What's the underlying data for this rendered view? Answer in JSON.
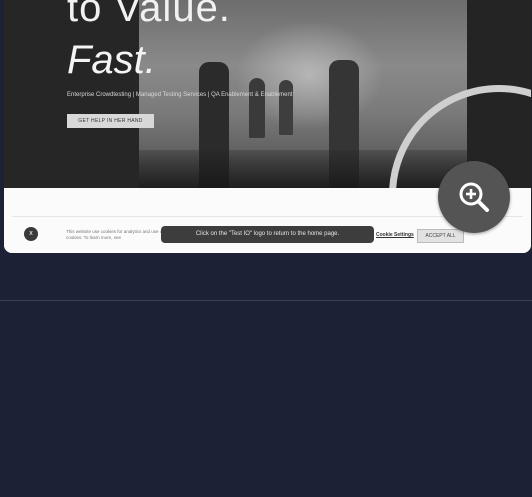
{
  "hero": {
    "headline_line1": "to Value.",
    "headline_line2": "Fast.",
    "subline": "Enterprise Crowdtesting | Managed Testing Services | QA Enablement & Enablement",
    "cta_label": "GET HELP IN HER HAND"
  },
  "cookie_banner": {
    "close_label": "x",
    "text": "This website use cookies for analytics and use of cookies. To learn more, see",
    "link_label": "Cookie Settings",
    "accept_label": "ACCEPT ALL"
  },
  "tooltip": {
    "text": "Click on the \"Test IO\" logo to return to the home page."
  },
  "zoom": {
    "icon": "zoom-in-icon"
  }
}
